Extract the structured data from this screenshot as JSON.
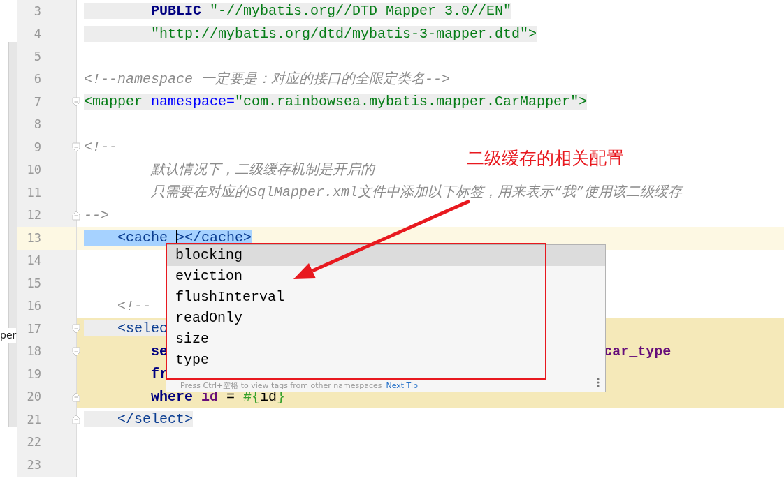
{
  "side_panel": {
    "label": "per"
  },
  "lines": [
    {
      "number": "3",
      "tokens": [
        {
          "kind": "keyword",
          "text": "        PUBLIC",
          "shaded": true
        },
        {
          "kind": "string",
          "text": " \"-//mybatis.org//DTD Mapper 3.0//EN\"",
          "shaded": true
        }
      ]
    },
    {
      "number": "4",
      "tokens": [
        {
          "kind": "string",
          "text": "        \"http://mybatis.org/dtd/mybatis-3-mapper.dtd\"",
          "shaded": true
        },
        {
          "kind": "tag",
          "text": ">",
          "shaded": true
        }
      ]
    },
    {
      "number": "5"
    },
    {
      "number": "6",
      "tokens": [
        {
          "kind": "comment",
          "text": "<!--namespace 一定要是：对应的接口的全限定类名-->"
        }
      ]
    },
    {
      "number": "7",
      "fold_marker": {
        "kind": "open"
      },
      "tokens": [
        {
          "kind": "tag",
          "text": "<mapper ",
          "shaded": true
        },
        {
          "kind": "attr",
          "text": "namespace=",
          "shaded": true
        },
        {
          "kind": "string",
          "text": "\"com.rainbowsea.mybatis.mapper.CarMapper\"",
          "shaded": true
        },
        {
          "kind": "tag",
          "text": ">",
          "shaded": true
        }
      ]
    },
    {
      "number": "8"
    },
    {
      "number": "9",
      "fold_marker": {
        "kind": "open"
      },
      "tokens": [
        {
          "kind": "comment",
          "text": "<!--"
        }
      ]
    },
    {
      "number": "10",
      "tokens": [
        {
          "kind": "comment",
          "text": "        默认情况下，二级缓存机制是开启的"
        }
      ]
    },
    {
      "number": "11",
      "tokens": [
        {
          "kind": "comment",
          "text": "        只需要在对应的SqlMapper.xml文件中添加以下标签，用来表示“我”使用该二级缓存"
        }
      ]
    },
    {
      "number": "12",
      "fold_marker": {
        "kind": "close"
      },
      "tokens": [
        {
          "kind": "comment",
          "text": "-->"
        }
      ]
    },
    {
      "number": "13",
      "current": true,
      "tokens": [
        {
          "kind": "xmltag",
          "text": "    <cache ",
          "selected": true
        },
        {
          "kind": "xmltag",
          "text": "></cache>",
          "selected": true,
          "caret": true
        }
      ]
    },
    {
      "number": "14"
    },
    {
      "number": "15"
    },
    {
      "number": "16",
      "tokens": [
        {
          "kind": "comment",
          "text": "    <!--"
        }
      ]
    },
    {
      "number": "17",
      "fold_marker": {
        "kind": "open"
      },
      "injected": true,
      "tokens": [
        {
          "kind": "xmltag",
          "text": "    <selec",
          "shaded": true
        }
      ]
    },
    {
      "number": "18",
      "fold_marker": {
        "kind": "open"
      },
      "injected": true,
      "tokens": [
        {
          "kind": "keyword",
          "text": "        se"
        }
      ],
      "tail_tokens": [
        {
          "kind": "column",
          "text": "car_type"
        }
      ]
    },
    {
      "number": "19",
      "injected": true,
      "tokens": [
        {
          "kind": "keyword",
          "text": "        fr"
        }
      ]
    },
    {
      "number": "20",
      "fold_marker": {
        "kind": "close"
      },
      "injected": true,
      "tokens": [
        {
          "kind": "keyword",
          "text": "        where "
        },
        {
          "kind": "column",
          "text": "id"
        },
        {
          "kind": "plain",
          "text": " = "
        },
        {
          "kind": "param",
          "text": "#{"
        },
        {
          "kind": "plain",
          "text": "id"
        },
        {
          "kind": "param",
          "text": "}"
        }
      ]
    },
    {
      "number": "21",
      "fold_marker": {
        "kind": "close"
      },
      "tokens": [
        {
          "kind": "xmltag",
          "text": "    </select>",
          "shaded": true
        }
      ]
    },
    {
      "number": "22"
    },
    {
      "number": "23"
    }
  ],
  "completion_popup": {
    "items": [
      {
        "label": "blocking",
        "selected": true
      },
      {
        "label": "eviction",
        "selected": false
      },
      {
        "label": "flushInterval",
        "selected": false
      },
      {
        "label": "readOnly",
        "selected": false
      },
      {
        "label": "size",
        "selected": false
      },
      {
        "label": "type",
        "selected": false
      }
    ],
    "hint": "Press Ctrl+空格 to view tags from other namespaces",
    "link": "Next Tip"
  },
  "annotation": {
    "text": "二级缓存的相关配置"
  }
}
